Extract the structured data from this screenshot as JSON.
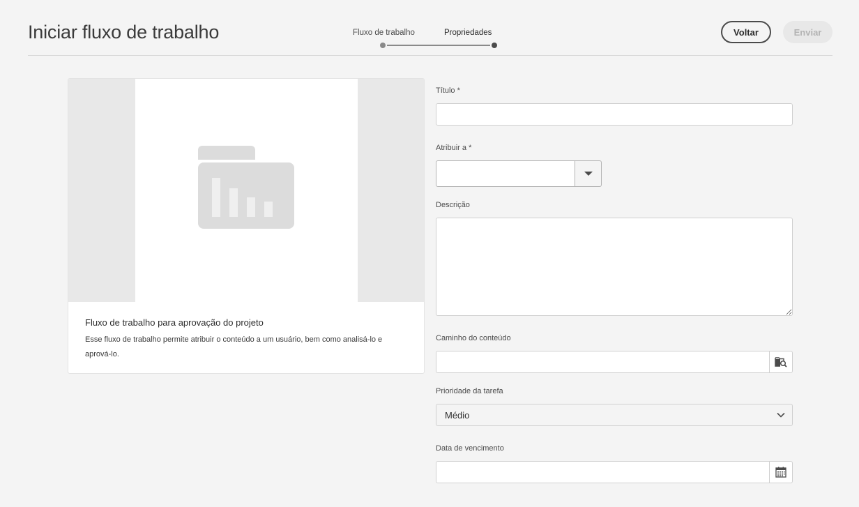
{
  "header": {
    "title": "Iniciar fluxo de trabalho",
    "steps": [
      {
        "label": "Fluxo de trabalho",
        "state": "complete"
      },
      {
        "label": "Propriedades",
        "state": "current"
      }
    ],
    "back_label": "Voltar",
    "submit_label": "Enviar"
  },
  "card": {
    "title": "Fluxo de trabalho para aprovação do projeto",
    "description": "Esse fluxo de trabalho permite atribuir o conteúdo a um usuário, bem como analisá-lo e aprová-lo."
  },
  "form": {
    "title_label": "Título *",
    "title_value": "",
    "assign_label": "Atribuir a *",
    "assign_value": "",
    "description_label": "Descrição",
    "description_value": "",
    "content_path_label": "Caminho do conteúdo",
    "content_path_value": "",
    "priority_label": "Prioridade da tarefa",
    "priority_value": "Médio",
    "due_date_label": "Data de vencimento",
    "due_date_value": ""
  },
  "icons": {
    "assign_toggle": "caret-down-icon",
    "content_path_browse": "folder-search-icon",
    "priority_chevron": "chevron-down-icon",
    "due_date_picker": "calendar-icon",
    "card_thumbnail": "folder-chart-icon"
  }
}
